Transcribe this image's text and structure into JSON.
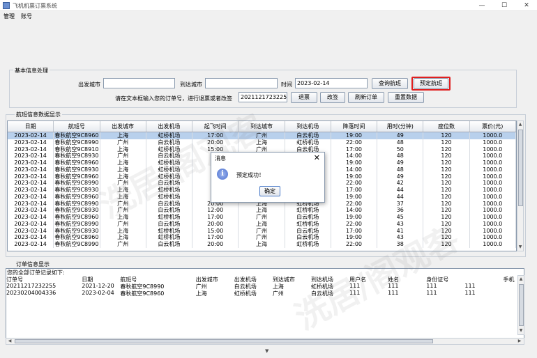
{
  "window": {
    "title": "飞机机票订票系统",
    "minimize_icon": "minimize-icon",
    "maximize_icon": "maximize-icon",
    "close_icon": "close-icon",
    "minimize": "—",
    "maximize": "☐",
    "close": "✕"
  },
  "menu": [
    "管理",
    "账号"
  ],
  "basic": {
    "legend": "基本信息处理",
    "depart_city_label": "出发城市",
    "depart_city_value": "",
    "arrive_city_label": "到达城市",
    "arrive_city_value": "",
    "time_label": "时间",
    "time_value": "2023-02-14",
    "query_button": "查询航班",
    "book_button": "预定航班",
    "order_prompt": "请在文本框输入您的订单号，进行退票或者改签",
    "order_value": "20211217232255",
    "refund_button": "退票",
    "change_button": "改签",
    "refresh_button": "刷新订单",
    "reset_button": "重置数据"
  },
  "flights": {
    "legend": "航班信息数据显示",
    "columns": [
      "日期",
      "航班号",
      "出发城市",
      "出发机场",
      "起飞时间",
      "到达城市",
      "到达机场",
      "降落时间",
      "用时(分钟)",
      "座位数",
      "票价(元)"
    ],
    "rows": [
      [
        "2023-02-14",
        "春秋航空9C8960",
        "上海",
        "虹桥机场",
        "17:00",
        "广州",
        "白云机场",
        "19:00",
        "49",
        "120",
        "1000.0"
      ],
      [
        "2023-02-14",
        "春秋航空9C8990",
        "广州",
        "白云机场",
        "20:00",
        "上海",
        "虹桥机场",
        "22:00",
        "48",
        "120",
        "1000.0"
      ],
      [
        "2023-02-14",
        "春秋航空9C8910",
        "上海",
        "虹桥机场",
        "15:00",
        "广州",
        "白云机场",
        "17:00",
        "50",
        "120",
        "1000.0"
      ],
      [
        "2023-02-14",
        "春秋航空9C8930",
        "广州",
        "白云机场",
        "",
        "",
        "",
        "14:00",
        "48",
        "120",
        "1000.0"
      ],
      [
        "2023-02-14",
        "春秋航空9C8960",
        "上海",
        "虹桥机场",
        "",
        "",
        "",
        "19:00",
        "49",
        "120",
        "1000.0"
      ],
      [
        "2023-02-14",
        "春秋航空9C8930",
        "上海",
        "虹桥机场",
        "",
        "",
        "",
        "14:00",
        "48",
        "120",
        "1000.0"
      ],
      [
        "2023-02-14",
        "春秋航空9C8960",
        "上海",
        "虹桥机场",
        "",
        "",
        "",
        "19:00",
        "49",
        "120",
        "1000.0"
      ],
      [
        "2023-02-14",
        "春秋航空9C8990",
        "广州",
        "白云机场",
        "",
        "",
        "",
        "22:00",
        "42",
        "120",
        "1000.0"
      ],
      [
        "2023-02-14",
        "春秋航空9C8930",
        "上海",
        "虹桥机场",
        "",
        "",
        "",
        "17:00",
        "44",
        "120",
        "1000.0"
      ],
      [
        "2023-02-14",
        "春秋航空9C8960",
        "上海",
        "虹桥机场",
        "",
        "",
        "",
        "19:00",
        "44",
        "120",
        "1000.0"
      ],
      [
        "2023-02-14",
        "春秋航空9C8990",
        "广州",
        "白云机场",
        "20:00",
        "上海",
        "虹桥机场",
        "22:00",
        "37",
        "120",
        "1000.0"
      ],
      [
        "2023-02-14",
        "春秋航空9C8930",
        "广州",
        "白云机场",
        "12:00",
        "上海",
        "虹桥机场",
        "14:00",
        "36",
        "120",
        "1000.0"
      ],
      [
        "2023-02-14",
        "春秋航空9C8960",
        "上海",
        "虹桥机场",
        "17:00",
        "广州",
        "白云机场",
        "19:00",
        "45",
        "120",
        "1000.0"
      ],
      [
        "2023-02-14",
        "春秋航空9C8990",
        "广州",
        "白云机场",
        "20:00",
        "上海",
        "虹桥机场",
        "22:00",
        "43",
        "120",
        "1000.0"
      ],
      [
        "2023-02-14",
        "春秋航空9C8930",
        "上海",
        "虹桥机场",
        "15:00",
        "广州",
        "白云机场",
        "17:00",
        "41",
        "120",
        "1000.0"
      ],
      [
        "2023-02-14",
        "春秋航空9C8960",
        "上海",
        "虹桥机场",
        "17:00",
        "广州",
        "白云机场",
        "19:00",
        "43",
        "120",
        "1000.0"
      ],
      [
        "2023-02-14",
        "春秋航空9C8990",
        "广州",
        "白云机场",
        "20:00",
        "上海",
        "虹桥机场",
        "22:00",
        "38",
        "120",
        "1000.0"
      ]
    ]
  },
  "orders": {
    "legend": "订单信息显示",
    "intro": "您的全部订单记录如下:",
    "columns": [
      "订单号",
      "日期",
      "航班号",
      "出发城市",
      "出发机场",
      "到达城市",
      "到达机场",
      "用户名",
      "姓名",
      "身份证号",
      "",
      "手机"
    ],
    "rows": [
      [
        "20211217232255",
        "2021-12-20",
        "春秋航空9C8990",
        "广州",
        "白云机场",
        "上海",
        "虹桥机场",
        "111",
        "111",
        "111",
        "111",
        ""
      ],
      [
        "20230204004336",
        "2023-02-04",
        "春秋航空9C8960",
        "上海",
        "虹桥机场",
        "广州",
        "白云机场",
        "111",
        "111",
        "111",
        "111",
        ""
      ]
    ]
  },
  "dialog": {
    "title": "消息",
    "message": "预定成功！",
    "ok": "确定",
    "close": "✕",
    "icon": "i"
  },
  "scroll": {
    "up": "▲",
    "down": "▼",
    "left": "◀",
    "right": "▶",
    "splitter": "▼"
  },
  "watermark": "洗居/阁观客"
}
